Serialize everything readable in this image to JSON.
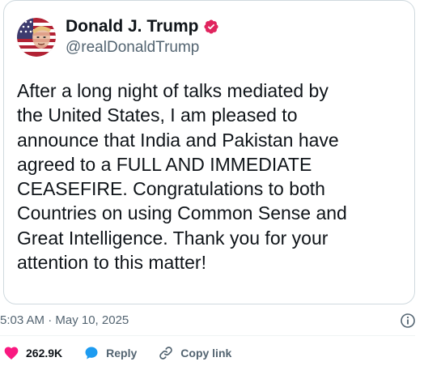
{
  "post": {
    "author": {
      "display_name": "Donald J. Trump",
      "handle": "@realDonaldTrump",
      "avatar_icon": "avatar-portrait",
      "verified_icon": "verified-badge-icon",
      "verified_color": "#e0245e"
    },
    "text": "After a long night of talks mediated by\nthe United States, I am pleased to\nannounce that India and Pakistan have\nagreed to a FULL AND IMMEDIATE\nCEASEFIRE. Congratulations to both\nCountries on using Common Sense and\nGreat Intelligence. Thank you for your\nattention to this matter!",
    "timestamp": "5:03 AM · May 10, 2025"
  },
  "actions": {
    "like": {
      "count": "262.9K",
      "icon": "heart-icon",
      "color": "#f91880"
    },
    "reply": {
      "label": "Reply",
      "icon": "reply-bubble-icon",
      "color": "#1d9bf0"
    },
    "copy_link": {
      "label": "Copy link",
      "icon": "link-icon"
    }
  },
  "colors": {
    "text_primary": "#0f1419",
    "text_secondary": "#536471",
    "border": "#cfd9de"
  }
}
